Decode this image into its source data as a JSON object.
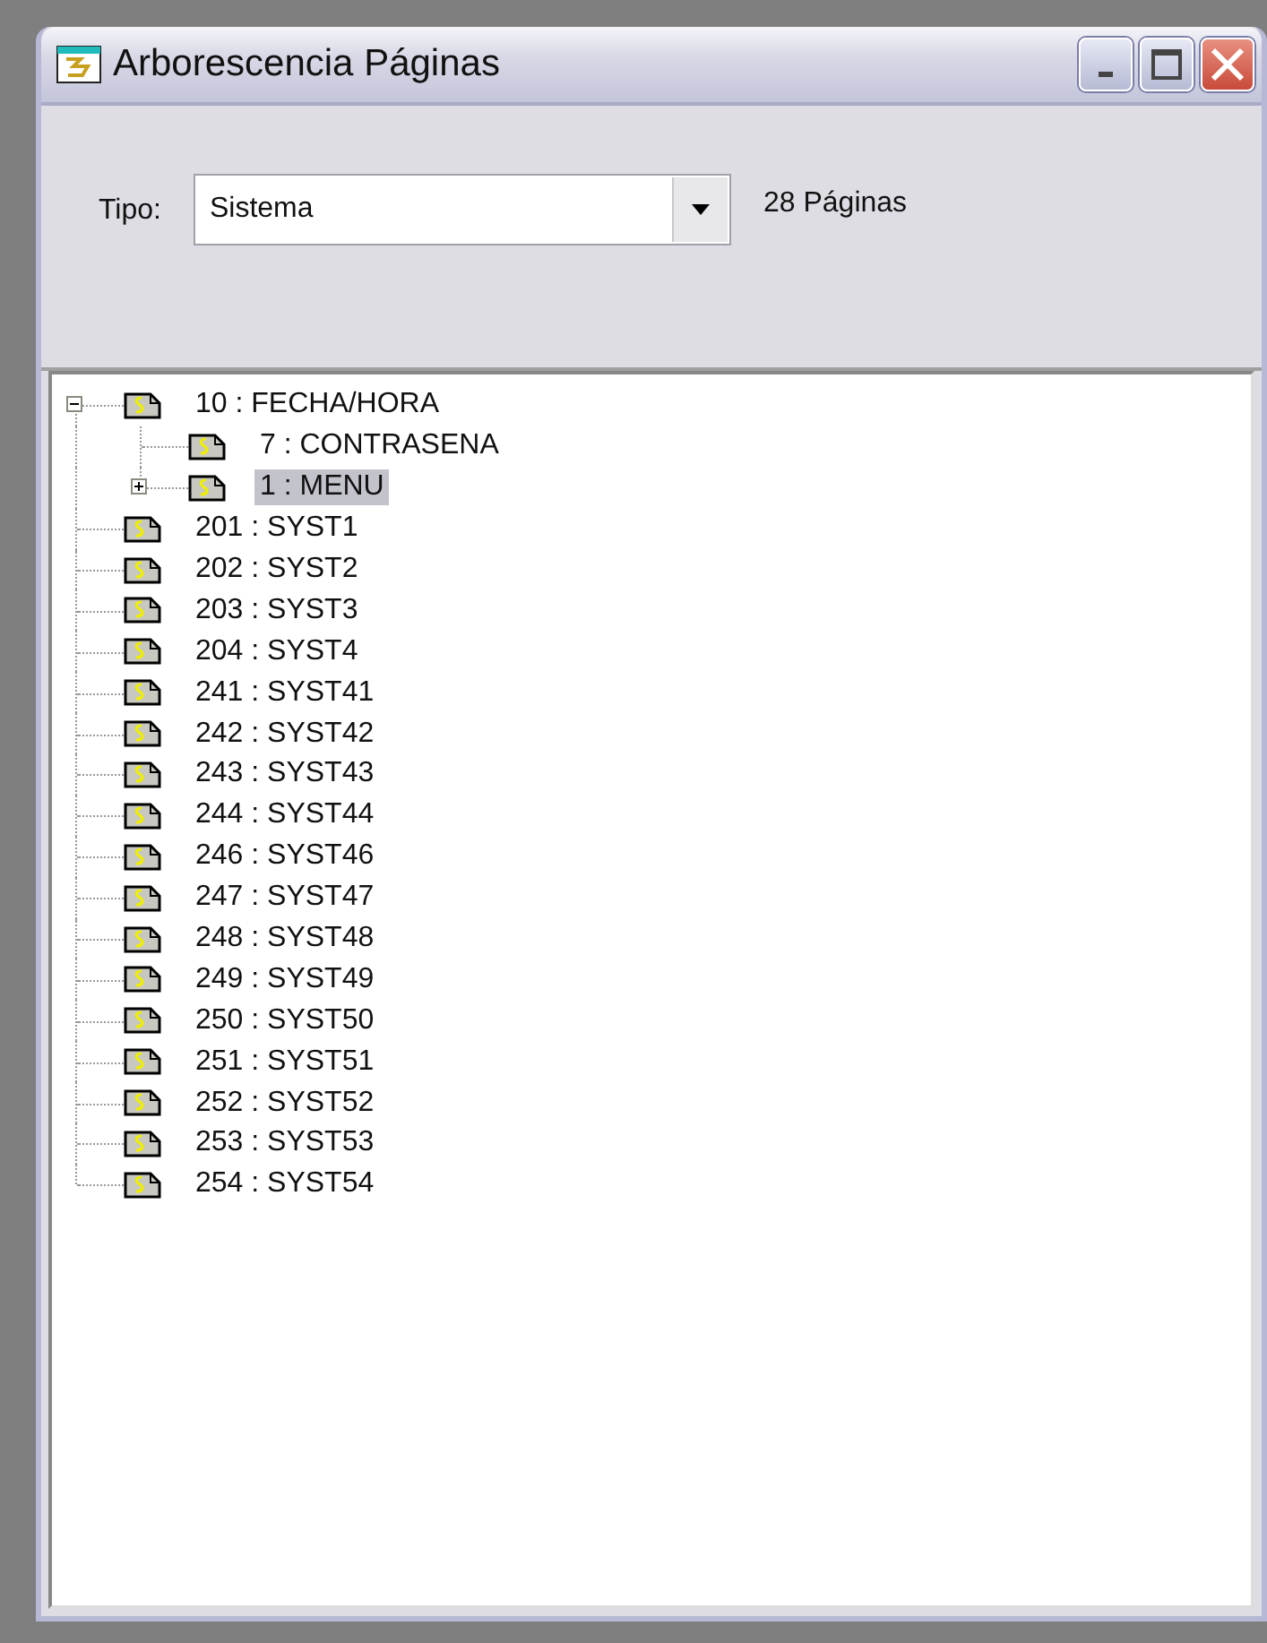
{
  "window": {
    "title": "Arborescencia Páginas"
  },
  "filter": {
    "label": "Tipo:",
    "value": "Sistema",
    "count": "28 Páginas"
  },
  "tree": [
    {
      "label": "10 : FECHA/HORA",
      "selected": false,
      "expanded": true,
      "children": [
        {
          "label": "7 : CONTRASENA",
          "selected": false
        },
        {
          "label": "1 : MENU",
          "selected": true,
          "expanded": false
        }
      ]
    },
    {
      "label": "201 : SYST1",
      "selected": false
    },
    {
      "label": "202 : SYST2",
      "selected": false
    },
    {
      "label": "203 : SYST3",
      "selected": false
    },
    {
      "label": "204 : SYST4",
      "selected": false
    },
    {
      "label": "241 : SYST41",
      "selected": false
    },
    {
      "label": "242 : SYST42",
      "selected": false
    },
    {
      "label": "243 : SYST43",
      "selected": false
    },
    {
      "label": "244 : SYST44",
      "selected": false
    },
    {
      "label": "246 : SYST46",
      "selected": false
    },
    {
      "label": "247 : SYST47",
      "selected": false
    },
    {
      "label": "248 : SYST48",
      "selected": false
    },
    {
      "label": "249 : SYST49",
      "selected": false
    },
    {
      "label": "250 : SYST50",
      "selected": false
    },
    {
      "label": "251 : SYST51",
      "selected": false
    },
    {
      "label": "252 : SYST52",
      "selected": false
    },
    {
      "label": "253 : SYST53",
      "selected": false
    },
    {
      "label": "254 : SYST54",
      "selected": false
    }
  ]
}
